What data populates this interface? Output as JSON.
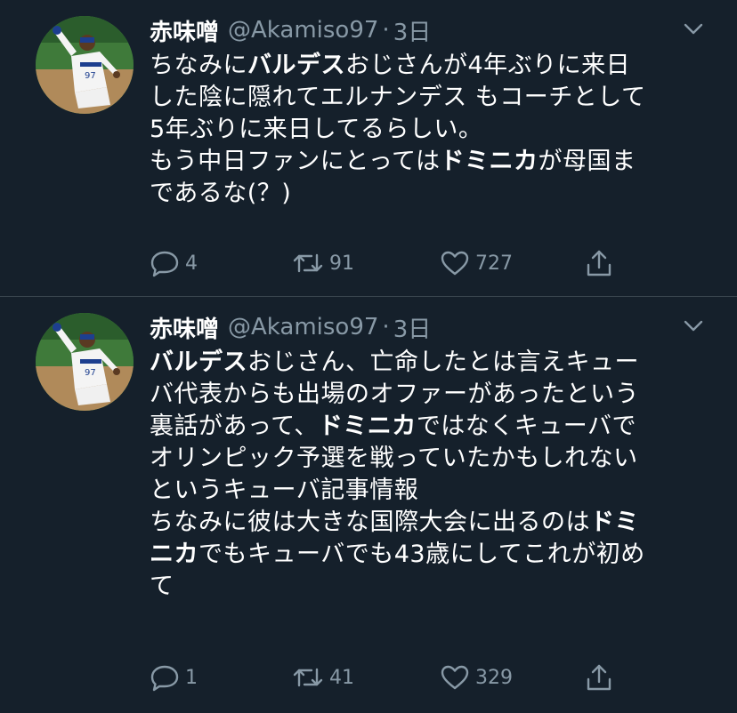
{
  "tweets": [
    {
      "author_name": "赤味噌",
      "handle": "@Akamiso97",
      "separator": "·",
      "time": "3日",
      "body_lines": [
        [
          {
            "t": "ちなみに"
          },
          {
            "t": "バルデス",
            "b": true
          },
          {
            "t": "おじさんが4年ぶりに来日"
          }
        ],
        [
          {
            "t": "した陰に隠れてエルナンデス もコーチとして"
          }
        ],
        [
          {
            "t": "5年ぶりに来日してるらしい。"
          }
        ],
        [
          {
            "t": "もう中日ファンにとっては"
          },
          {
            "t": "ドミニカ",
            "b": true
          },
          {
            "t": "が母国ま"
          }
        ],
        [
          {
            "t": "であるな(？)"
          }
        ]
      ],
      "replies": "4",
      "retweets": "91",
      "likes": "727"
    },
    {
      "author_name": "赤味噌",
      "handle": "@Akamiso97",
      "separator": "·",
      "time": "3日",
      "body_lines": [
        [
          {
            "t": "バルデス",
            "b": true
          },
          {
            "t": "おじさん、亡命したとは言えキュー"
          }
        ],
        [
          {
            "t": "バ代表からも出場のオファーがあったという"
          }
        ],
        [
          {
            "t": "裏話があって、"
          },
          {
            "t": "ドミニカ",
            "b": true
          },
          {
            "t": "ではなくキューバで"
          }
        ],
        [
          {
            "t": "オリンピック予選を戦っていたかもしれない"
          }
        ],
        [
          {
            "t": "というキューバ記事情報"
          }
        ],
        [
          {
            "t": "ちなみに彼は大きな国際大会に出るのは"
          },
          {
            "t": "ドミ",
            "b": true
          }
        ],
        [
          {
            "t": "ニカ",
            "b": true
          },
          {
            "t": "でもキューバでも43歳にしてこれが初め"
          }
        ],
        [
          {
            "t": "て"
          }
        ]
      ],
      "replies": "1",
      "retweets": "41",
      "likes": "329"
    }
  ],
  "icons": {
    "reply": "reply-icon",
    "retweet": "retweet-icon",
    "like": "like-icon",
    "share": "share-icon",
    "caret": "chevron-down-icon"
  },
  "colors": {
    "background": "#15202b",
    "text_primary": "#ffffff",
    "text_secondary": "#8899a6",
    "divider": "#38444d"
  }
}
